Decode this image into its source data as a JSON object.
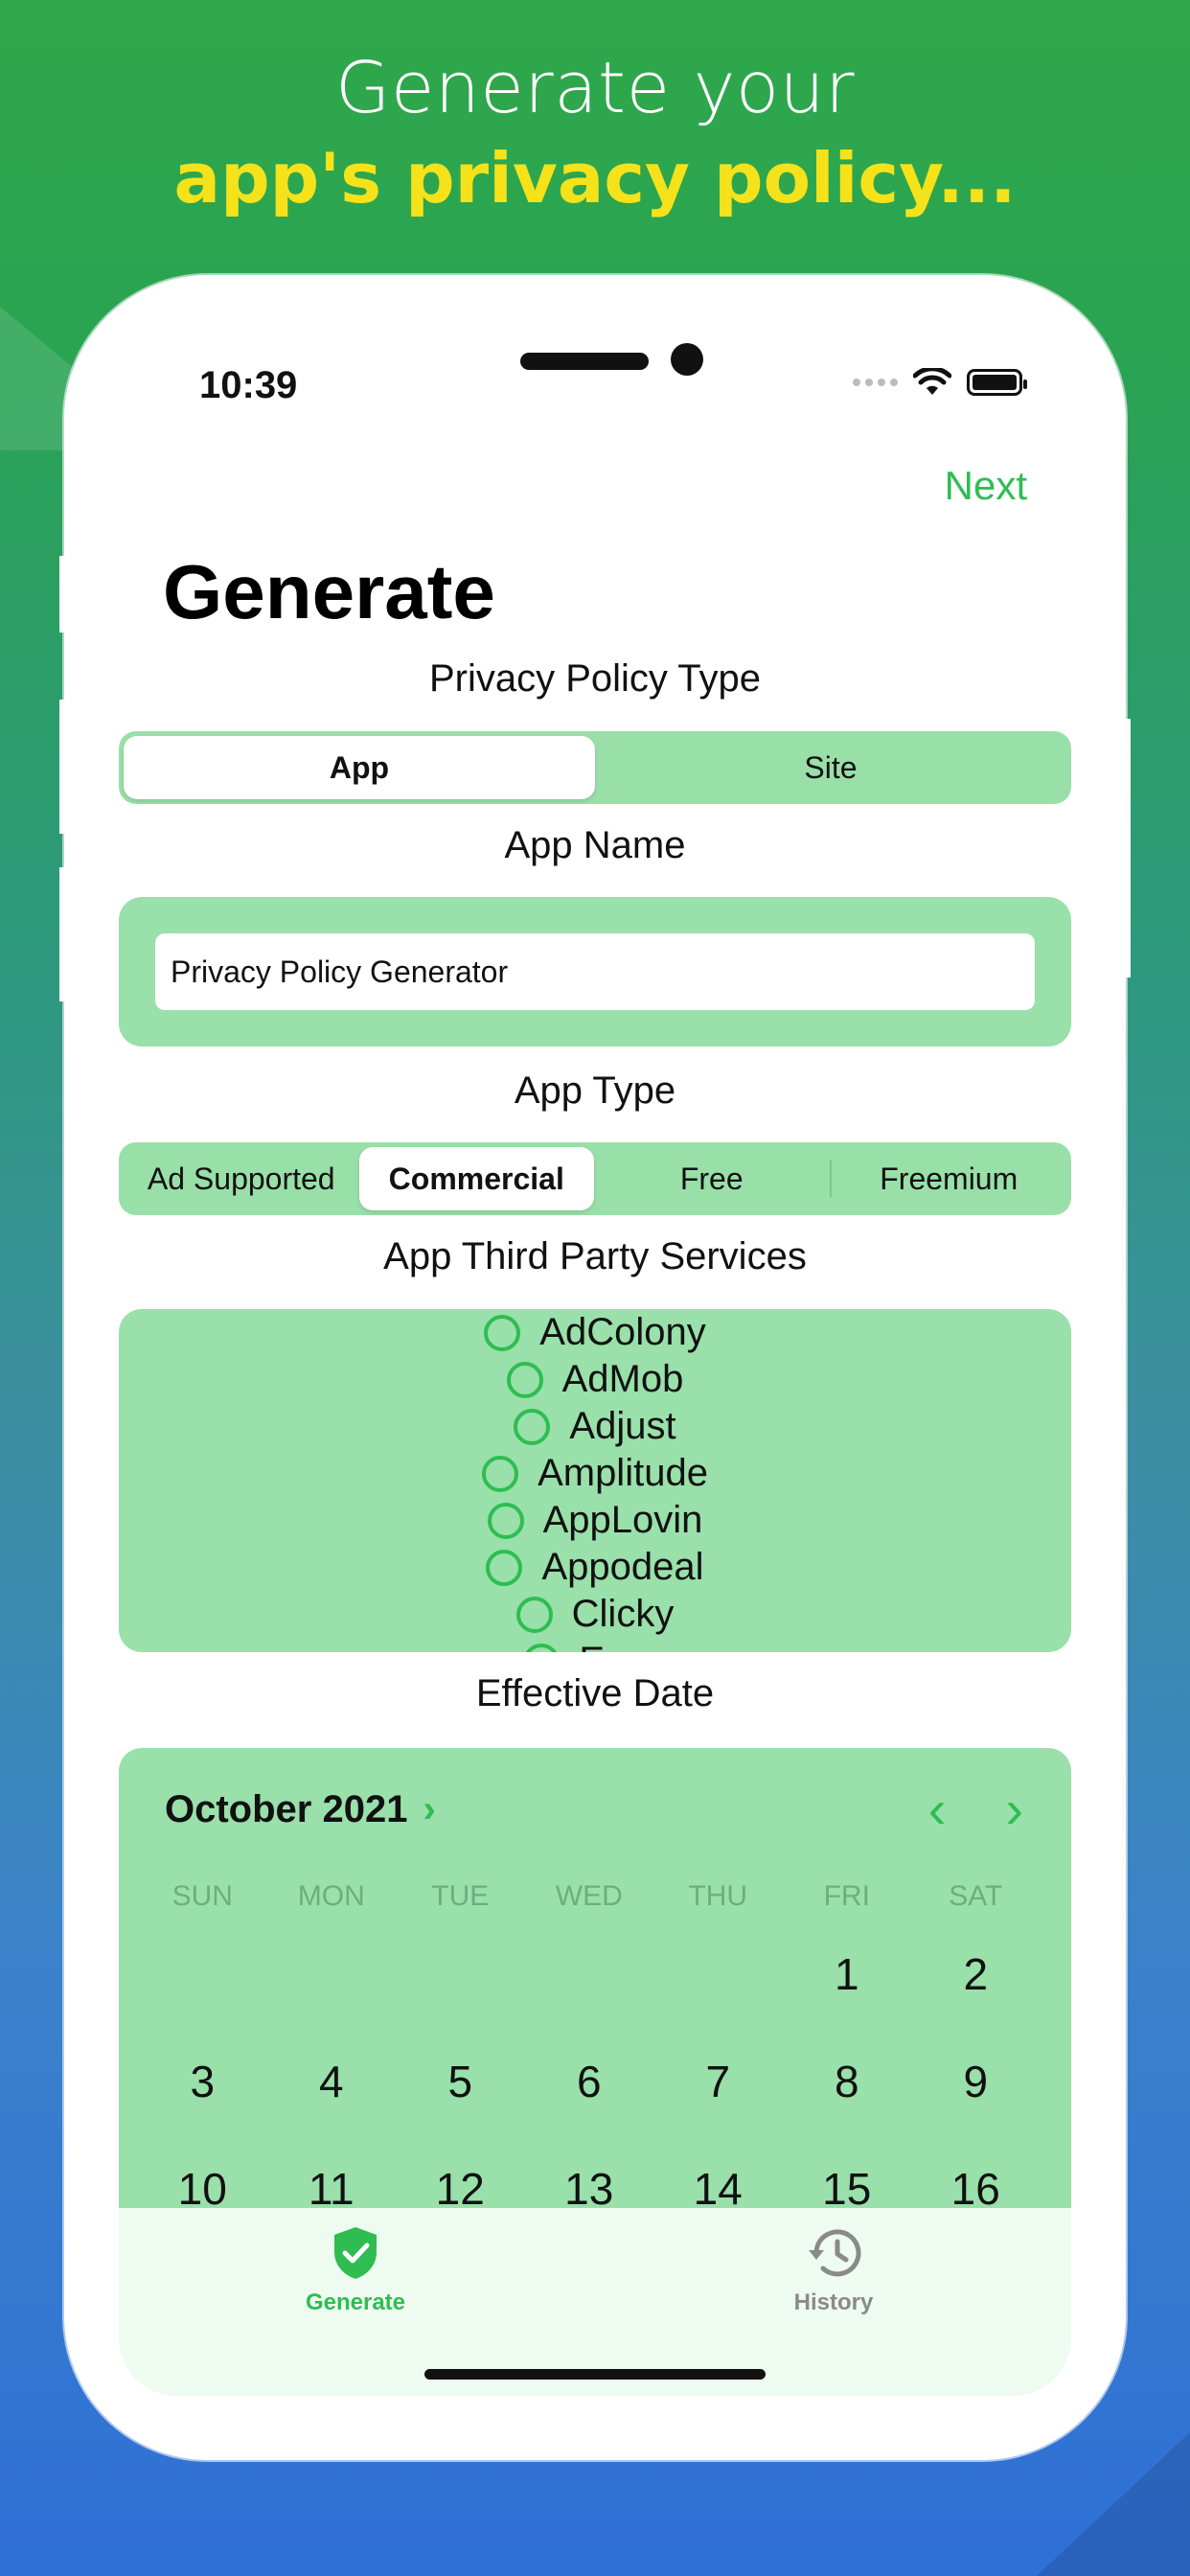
{
  "headline": {
    "line1": "Generate your",
    "line2": "app's privacy policy..."
  },
  "status": {
    "time": "10:39"
  },
  "nav": {
    "next_label": "Next",
    "title": "Generate"
  },
  "policy_type": {
    "label": "Privacy Policy Type",
    "options": [
      "App",
      "Site"
    ],
    "selected": "App"
  },
  "app_name": {
    "label": "App Name",
    "value": "Privacy Policy Generator"
  },
  "app_type": {
    "label": "App Type",
    "options": [
      "Ad Supported",
      "Commercial",
      "Free",
      "Freemium"
    ],
    "selected": "Commercial"
  },
  "third_party": {
    "label": "App Third Party Services",
    "services": [
      "AdColony",
      "AdMob",
      "Adjust",
      "Amplitude",
      "AppLovin",
      "Appodeal",
      "Clicky",
      "Expo"
    ]
  },
  "effective_date": {
    "label": "Effective Date",
    "month": "October 2021",
    "weekdays": [
      "SUN",
      "MON",
      "TUE",
      "WED",
      "THU",
      "FRI",
      "SAT"
    ],
    "weeks": [
      [
        "",
        "",
        "",
        "",
        "",
        "1",
        "2"
      ],
      [
        "3",
        "4",
        "5",
        "6",
        "7",
        "8",
        "9"
      ],
      [
        "10",
        "11",
        "12",
        "13",
        "14",
        "15",
        "16"
      ]
    ]
  },
  "tabs": {
    "generate": "Generate",
    "history": "History"
  },
  "colors": {
    "accent": "#2fbd52",
    "panel": "#99e0aa",
    "headline_yellow": "#f5e21a"
  }
}
